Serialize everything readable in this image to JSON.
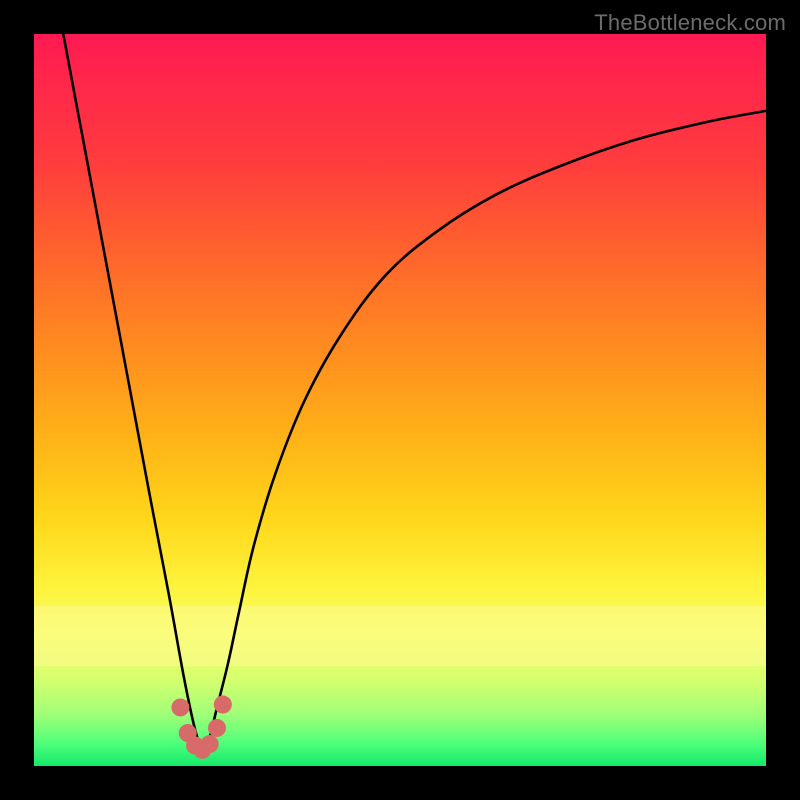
{
  "watermark": "TheBottleneck.com",
  "colors": {
    "frame": "#000000",
    "curve": "#000000",
    "dots": "#d96a6a",
    "gradient_top": "#ff1a52",
    "gradient_bottom": "#14e86b"
  },
  "chart_data": {
    "type": "line",
    "title": "",
    "xlabel": "",
    "ylabel": "",
    "xlim": [
      0,
      100
    ],
    "ylim": [
      0,
      100
    ],
    "note": "Values estimated from pixel positions; y=0 at bottom (green) → y=100 at top (red). Minimum near x≈23.",
    "series": [
      {
        "name": "curve",
        "x": [
          4,
          7,
          10,
          13,
          16,
          18.5,
          20.5,
          22,
          23,
          24,
          25,
          26.5,
          28,
          30,
          33,
          37,
          42,
          48,
          55,
          63,
          72,
          82,
          92,
          100
        ],
        "y": [
          100,
          84,
          68,
          52,
          36,
          23,
          12,
          5,
          2.5,
          4,
          8,
          14,
          21,
          30,
          40,
          50,
          59,
          67,
          73,
          78,
          82,
          85.5,
          88,
          89.5
        ]
      }
    ],
    "dots": {
      "name": "highlight-dots",
      "x": [
        20.0,
        21.0,
        22.0,
        23.0,
        24.0,
        25.0,
        25.8
      ],
      "y": [
        8.0,
        4.5,
        2.8,
        2.2,
        3.0,
        5.2,
        8.4
      ]
    }
  }
}
